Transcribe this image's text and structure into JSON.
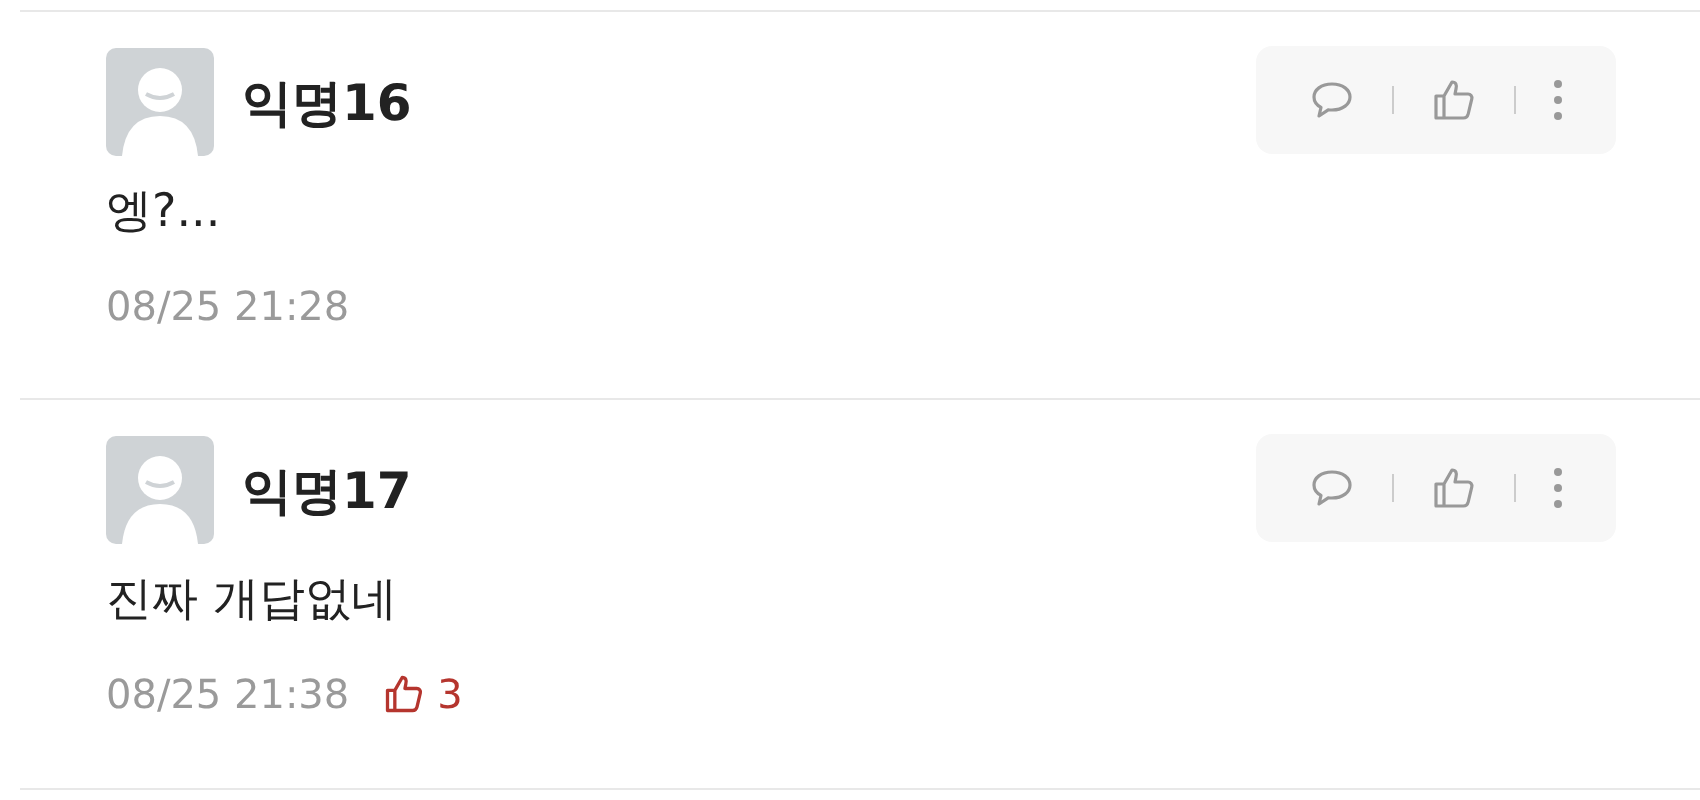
{
  "comments": [
    {
      "author": "익명16",
      "text": "엥?...",
      "time": "08/25 21:28"
    },
    {
      "author": "익명17",
      "text": "진짜 개답없네",
      "time": "08/25 21:38",
      "likes": "3"
    }
  ]
}
